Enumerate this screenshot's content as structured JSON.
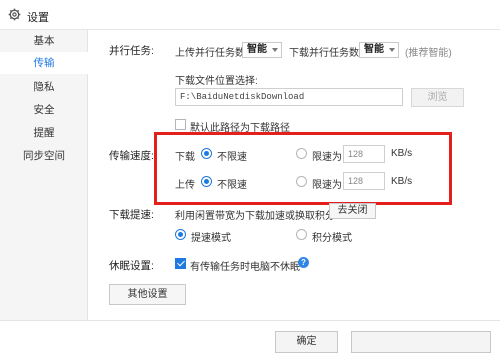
{
  "window": {
    "title": "设置",
    "icon": "gear-icon"
  },
  "sidebar": {
    "items": [
      {
        "label": "基本",
        "active": false
      },
      {
        "label": "传输",
        "active": true
      },
      {
        "label": "隐私",
        "active": false
      },
      {
        "label": "安全",
        "active": false
      },
      {
        "label": "提醒",
        "active": false
      },
      {
        "label": "同步空间",
        "active": false
      }
    ]
  },
  "parallel": {
    "label": "并行任务:",
    "upload_label": "上传并行任务数",
    "upload_value": "智能",
    "download_label": "下载并行任务数",
    "download_value": "智能",
    "hint": "(推荐智能)"
  },
  "download_location": {
    "label": "下载文件位置选择:",
    "path": "F:\\BaiduNetdiskDownload",
    "browse_label": "浏览",
    "default_checkbox_label": "默认此路径为下载路径",
    "default_checked": false
  },
  "speed": {
    "label": "传输速度:",
    "download": {
      "label": "下载",
      "unlimited_label": "不限速",
      "limit_label": "限速为",
      "limit_value": "128",
      "unit": "KB/s",
      "selected": "unlimited"
    },
    "upload": {
      "label": "上传",
      "unlimited_label": "不限速",
      "limit_label": "限速为",
      "limit_value": "128",
      "unit": "KB/s",
      "selected": "unlimited"
    }
  },
  "boost": {
    "label": "下载提速:",
    "text": "利用闲置带宽为下载加速或换取积分",
    "close_button": "去关闭",
    "mode_speed": "提速模式",
    "mode_points": "积分模式",
    "selected": "speed"
  },
  "sleep": {
    "label": "休眠设置:",
    "checkbox_label": "有传输任务时电脑不休眠",
    "checked": true
  },
  "other_settings_button": "其他设置",
  "footer": {
    "ok_button": "确定"
  },
  "colors": {
    "accent": "#1e7ae0",
    "highlight_border": "#e3201b"
  }
}
